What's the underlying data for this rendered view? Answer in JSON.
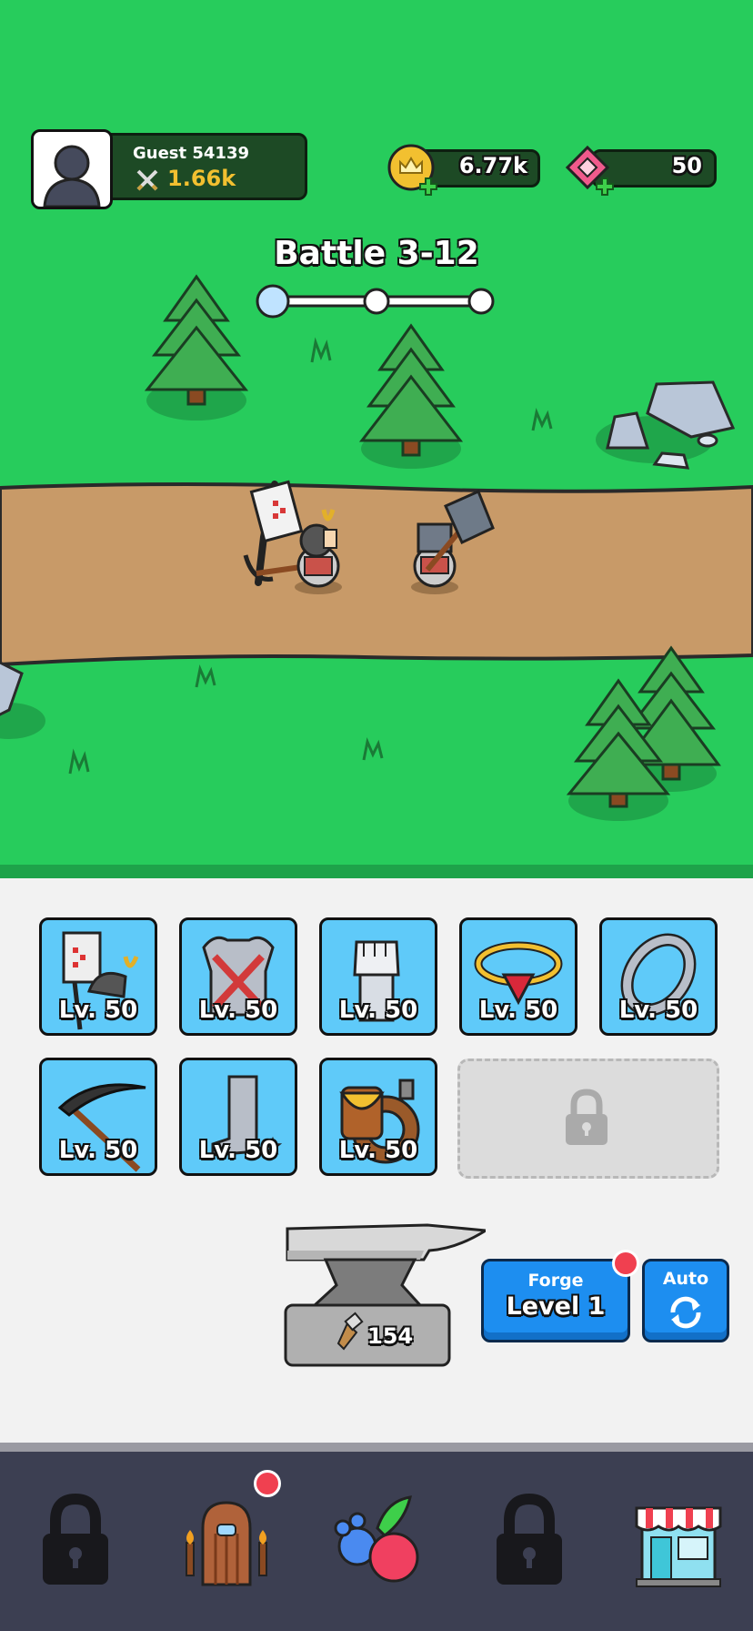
{
  "player": {
    "name": "Guest 54139",
    "power": "1.66k"
  },
  "currency": {
    "gold": "6.77k",
    "gems": "50"
  },
  "battle": {
    "title": "Battle 3-12",
    "stages_total": 3,
    "stages_current": 1
  },
  "inventory": {
    "row1": [
      {
        "item": "banner-helmet",
        "level": "Lv. 50"
      },
      {
        "item": "armor",
        "level": "Lv. 50"
      },
      {
        "item": "gauntlet",
        "level": "Lv. 50"
      },
      {
        "item": "necklace",
        "level": "Lv. 50"
      },
      {
        "item": "ring",
        "level": "Lv. 50"
      }
    ],
    "row2": [
      {
        "item": "scythe",
        "level": "Lv. 50"
      },
      {
        "item": "boots",
        "level": "Lv. 50"
      },
      {
        "item": "belt-pouch",
        "level": "Lv. 50"
      }
    ]
  },
  "forge": {
    "hammer_count": "154",
    "forge_label": "Forge",
    "level_label": "Level 1",
    "auto_label": "Auto"
  },
  "nav": {
    "items": [
      {
        "icon": "lock-icon",
        "locked": true
      },
      {
        "icon": "dungeon-door-icon",
        "notification": true
      },
      {
        "icon": "pets-icon"
      },
      {
        "icon": "lock-icon",
        "locked": true
      },
      {
        "icon": "shop-icon"
      }
    ]
  },
  "colors": {
    "grass": "#27cc5c",
    "path": "#c89a68",
    "slot_bg": "#5fcaf9",
    "button_blue": "#1d8ef0",
    "nav_bg": "#3c3f52",
    "badge_red": "#f04050"
  }
}
